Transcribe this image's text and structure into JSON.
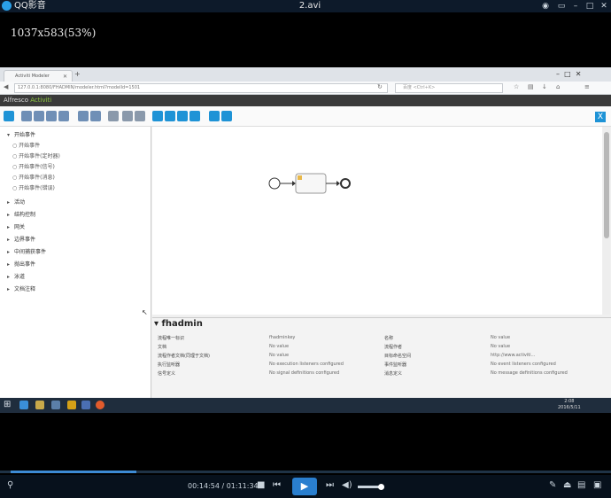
{
  "player": {
    "app_name": "QQ影音",
    "file_name": "2.avi",
    "resolution": "1037x583(53%)",
    "time_current": "00:14:54",
    "time_total": "01:11:34",
    "progress": 0.21,
    "volume": 0.85
  },
  "browser": {
    "tab_title": "Activiti Modeler",
    "url": "127.0.0.1:8080/FHADMIN/modeler.html?modelId=1501",
    "search_placeholder": "百度 <Ctrl+K>"
  },
  "app": {
    "brand_prefix": "Alfresco",
    "brand_suffix": "Activiti",
    "close_label": "X"
  },
  "palette": {
    "groups": [
      {
        "label": "开始事件",
        "expanded": true,
        "items": [
          "开始事件",
          "开始事件(定时器)",
          "开始事件(信号)",
          "开始事件(消息)",
          "开始事件(错误)"
        ]
      },
      {
        "label": "活动",
        "expanded": false,
        "items": []
      },
      {
        "label": "结构控制",
        "expanded": false,
        "items": []
      },
      {
        "label": "网关",
        "expanded": false,
        "items": []
      },
      {
        "label": "边界事件",
        "expanded": false,
        "items": []
      },
      {
        "label": "中间捕获事件",
        "expanded": false,
        "items": []
      },
      {
        "label": "抛出事件",
        "expanded": false,
        "items": []
      },
      {
        "label": "泳道",
        "expanded": false,
        "items": []
      },
      {
        "label": "文档注释",
        "expanded": false,
        "items": []
      }
    ]
  },
  "properties": {
    "title": "fhadmin",
    "rows": [
      {
        "l1": "流程唯一标识",
        "v1": "fhadminkey",
        "l2": "名称",
        "v2": "No value"
      },
      {
        "l1": "文档",
        "v1": "No value",
        "l2": "流程作者",
        "v2": "No value"
      },
      {
        "l1": "流程作者文档(同理于文档)",
        "v1": "No value",
        "l2": "目标命名空间",
        "v2": "http://www.activiti..."
      },
      {
        "l1": "执行监听器",
        "v1": "No execution listeners configured",
        "l2": "事件监听器",
        "v2": "No event listeners configured"
      },
      {
        "l1": "信号定义",
        "v1": "No signal definitions configured",
        "l2": "消息定义",
        "v2": "No message definitions configured"
      }
    ]
  },
  "taskbar": {
    "clock_time": "2:08",
    "clock_date": "2016/5/11"
  },
  "colors": {
    "accent": "#1e93d6",
    "brand_green": "#8cc63f",
    "player_bg": "#000000"
  },
  "icons": [
    "close-icon",
    "minimize-icon",
    "maximize-icon",
    "play-icon",
    "stop-icon",
    "prev-icon",
    "next-icon",
    "volume-icon"
  ]
}
